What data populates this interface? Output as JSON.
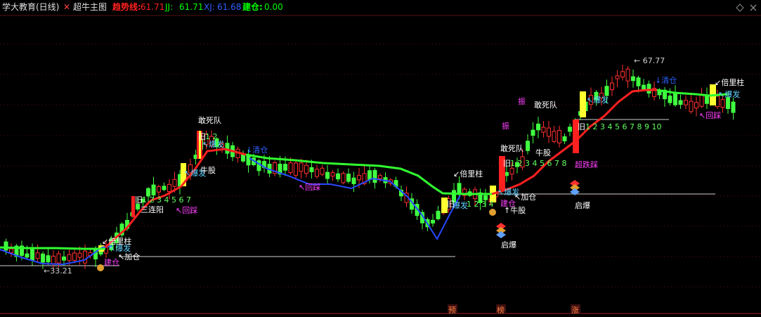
{
  "header": {
    "app_title": "学大教育(日线)",
    "indicator_name": "超牛主图",
    "trend_label": "趋势线:",
    "trend_value": "61.71",
    "jj_label": "JJ:",
    "jj_value": "61.71",
    "xj_label": "XJ:",
    "xj_value": "61.68",
    "jiancang_label": "建仓:",
    "jiancang_value": "0.00"
  },
  "colors": {
    "trend": "#ff2020",
    "jj": "#00ff00",
    "xj": "#3060ff",
    "jiancang": "#00ff00",
    "up_candle": "#ff3030",
    "down_candle": "#40ff40",
    "signal_text": "#ffffff",
    "baofa": "#60d0ff",
    "huicai": "#ff40ff",
    "beiliangzhu": "#ffff40"
  },
  "annotations": {
    "low_price": "33.21",
    "high_price": "67.77",
    "beiliangzhu": "倍里柱",
    "baofa": "爆发",
    "jiancang": "建仓",
    "jiacang": "加仓",
    "gansidui": "敢死队",
    "santianyang": "三连阳",
    "huicai": "回踩",
    "niugu": "牛股",
    "qingcang": "清仓",
    "qibao": "启爆",
    "zhen": "振",
    "chaodie": "超跌踩",
    "jiu": "旧",
    "count_short": "1 2 3 4 5 6 7",
    "count_mid": "1 2 3 4 5 6 7 8",
    "count_long": "1 2 3 4 5 6 7 8 9 10",
    "count_12": "1 2",
    "count_1234": "1 2 3 4"
  },
  "bottom_markers": [
    "预",
    "榜",
    "涨"
  ]
}
